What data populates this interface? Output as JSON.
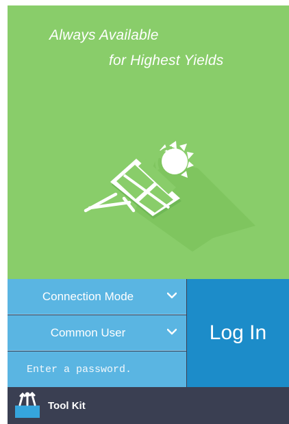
{
  "hero": {
    "slogan_line1": "Always Available",
    "slogan_line2": "for Highest Yields",
    "illustration_icon": "solar-panel-sun-icon",
    "background_color": "#89cd6a"
  },
  "login_form": {
    "connection_mode": {
      "label": "Connection Mode",
      "icon": "chevron-down-icon"
    },
    "user_type": {
      "label": "Common User",
      "icon": "chevron-down-icon"
    },
    "password": {
      "value": "",
      "placeholder": "Enter a password."
    },
    "login_button": {
      "label": "Log In"
    },
    "field_color": "#5ab5e2",
    "button_color": "#1c8cc9"
  },
  "toolbar": {
    "toolkit_label": "Tool Kit",
    "toolkit_icon": "toolbox-icon",
    "background_color": "#3a3f52"
  }
}
